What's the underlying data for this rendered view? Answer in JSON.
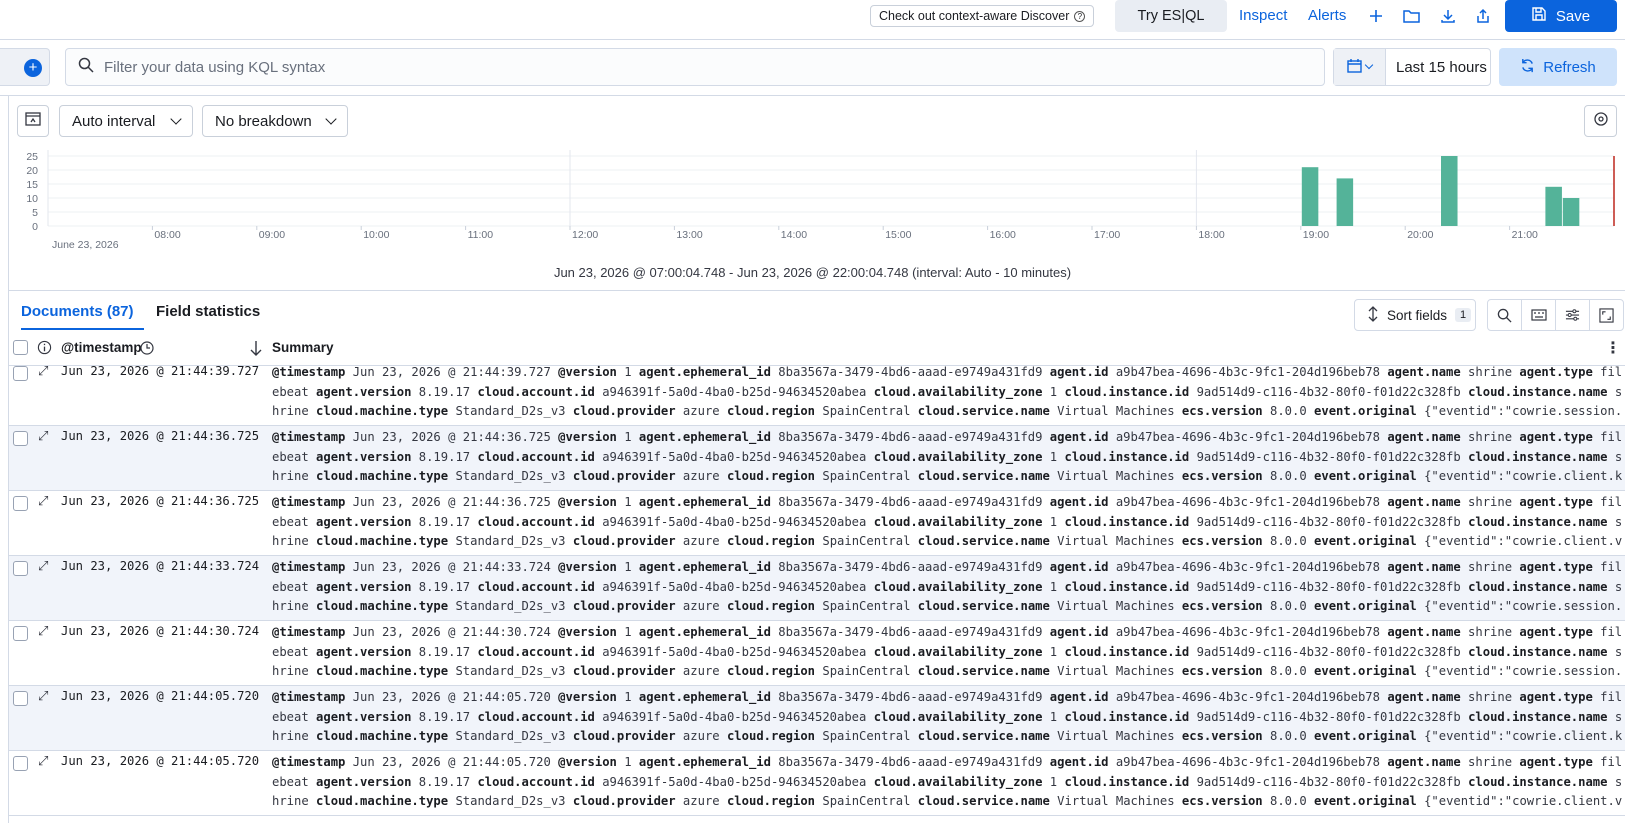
{
  "header": {
    "context_aware": "Check out context-aware Discover",
    "try_esql": "Try ES|QL",
    "inspect": "Inspect",
    "alerts": "Alerts",
    "save": "Save"
  },
  "query": {
    "placeholder": "Filter your data using KQL syntax",
    "date_range": "Last 15 hours",
    "refresh": "Refresh"
  },
  "histogram": {
    "interval": "Auto interval",
    "breakdown": "No breakdown",
    "y_ticks": [
      "25",
      "20",
      "15",
      "10",
      "5",
      "0"
    ],
    "date_label": "June 23, 2026",
    "range_text": "Jun 23, 2026 @ 07:00:04.748 - Jun 23, 2026 @ 22:00:04.748 (interval: Auto - 10 minutes)",
    "bar_color": "#54b399"
  },
  "chart_data": {
    "type": "bar",
    "x": [
      "08:00",
      "09:00",
      "10:00",
      "11:00",
      "12:00",
      "13:00",
      "14:00",
      "15:00",
      "16:00",
      "17:00",
      "18:00",
      "19:00",
      "20:00",
      "21:00"
    ],
    "bars": [
      {
        "time": "19:00",
        "value": 21
      },
      {
        "time": "19:20",
        "value": 17
      },
      {
        "time": "20:20",
        "value": 25
      },
      {
        "time": "21:20",
        "value": 14
      },
      {
        "time": "21:30",
        "value": 10
      }
    ],
    "ylim": [
      0,
      25
    ]
  },
  "tabs": {
    "documents": "Documents (87)",
    "field_statistics": "Field statistics"
  },
  "toolbar": {
    "sort_fields": "Sort fields",
    "sort_count": "1"
  },
  "table": {
    "col_timestamp": "@timestamp",
    "col_summary": "Summary",
    "rows": [
      {
        "ts": "Jun 23, 2026 @ 21:44:39.727",
        "tail": "{\"eventid\":\"cowrie.session.clos…"
      },
      {
        "ts": "Jun 23, 2026 @ 21:44:36.725",
        "tail": "{\"eventid\":\"cowrie.client.ke…"
      },
      {
        "ts": "Jun 23, 2026 @ 21:44:36.725",
        "tail": "{\"eventid\":\"cowrie.client.versi…"
      },
      {
        "ts": "Jun 23, 2026 @ 21:44:33.724",
        "tail": "{\"eventid\":\"cowrie.session.conn…"
      },
      {
        "ts": "Jun 23, 2026 @ 21:44:30.724",
        "tail": "{\"eventid\":\"cowrie.session.clos…"
      },
      {
        "ts": "Jun 23, 2026 @ 21:44:05.720",
        "tail": "{\"eventid\":\"cowrie.client.ke…"
      },
      {
        "ts": "Jun 23, 2026 @ 21:44:05.720",
        "tail": "{\"eventid\":\"cowrie.client.versi…"
      }
    ],
    "fields": {
      "version": "1",
      "ephemeral_id": "8ba3567a-3479-4bd6-aaad-e9749a431fd9",
      "agent_id": "a9b47bea-4696-4b3c-9fc1-204d196beb78",
      "agent_name": "shrine",
      "agent_type": "filebeat",
      "agent_version": "8.19.17",
      "account_id": "a946391f-5a0d-4ba0-b25d-94634520abea",
      "availability_zone": "1",
      "instance_id": "9ad514d9-c116-4b32-80f0-f01d22c328fb",
      "instance_name": "shrine",
      "machine_type": "Standard_D2s_v3",
      "provider": "azure",
      "region": "SpainCentral",
      "service_name": "Virtual Machines",
      "ecs_version": "8.0.0"
    }
  }
}
